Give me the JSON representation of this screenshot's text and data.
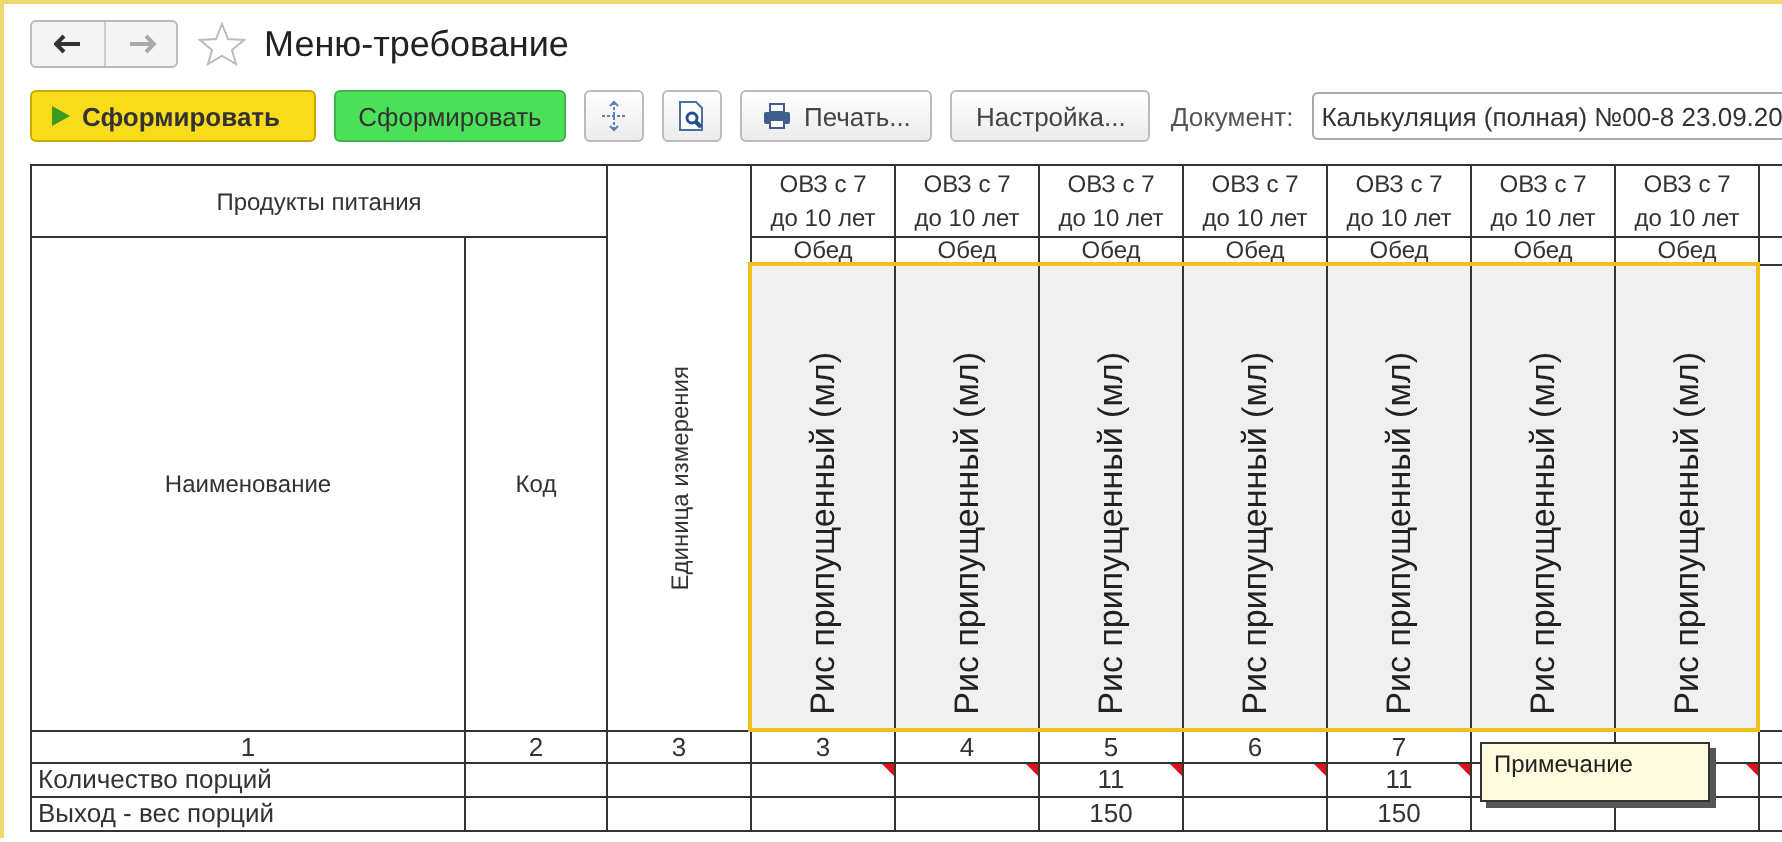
{
  "window": {
    "title": "Меню-требование"
  },
  "toolbar": {
    "buttons": [
      {
        "kind": "primary",
        "label": "Сформировать"
      },
      {
        "kind": "green",
        "label": "Сформировать"
      },
      {
        "kind": "move-icon"
      },
      {
        "kind": "preview-icon"
      },
      {
        "kind": "print",
        "label": "Печать..."
      },
      {
        "kind": "plain",
        "label": "Настройка..."
      }
    ],
    "document": {
      "label": "Документ:",
      "value": "Калькуляция (полная) №00-8 23.09.20"
    }
  },
  "table": {
    "group_header": "Продукты питания",
    "name_header": "Наименование",
    "code_header": "Код",
    "unit_header": "Единица измерения",
    "fixed_numbers": [
      "1",
      "2",
      "3"
    ],
    "dish_columns": [
      {
        "group": "ОВЗ с 7 до 10 лет",
        "meal": "Обед",
        "dish": "Рис припущенный (мл)",
        "number": "3",
        "note": true
      },
      {
        "group": "ОВЗ с 7 до 10 лет",
        "meal": "Обед",
        "dish": "Рис припущенный (мл)",
        "number": "4",
        "note": true
      },
      {
        "group": "ОВЗ с 7 до 10 лет",
        "meal": "Обед",
        "dish": "Рис припущенный (мл)",
        "number": "5",
        "note": true,
        "portions": "11",
        "yield": "150"
      },
      {
        "group": "ОВЗ с 7 до 10 лет",
        "meal": "Обед",
        "dish": "Рис припущенный (мл)",
        "number": "6",
        "note": true
      },
      {
        "group": "ОВЗ с 7 до 10 лет",
        "meal": "Обед",
        "dish": "Рис припущенный (мл)",
        "number": "7",
        "note": true,
        "portions": "11",
        "yield": "150"
      },
      {
        "group": "ОВЗ с 7 до 10 лет",
        "meal": "Обед",
        "dish": "Рис припущенный (мл)",
        "note": false
      },
      {
        "group": "ОВЗ с 7 до 10 лет",
        "meal": "Обед",
        "dish": "Рис припущенный (мл)",
        "note": true
      }
    ],
    "rows": [
      {
        "kind": "portions",
        "name": "Количество порций"
      },
      {
        "kind": "yield",
        "name": "Выход - вес порций"
      }
    ]
  },
  "tooltip": {
    "text": "Примечание"
  }
}
